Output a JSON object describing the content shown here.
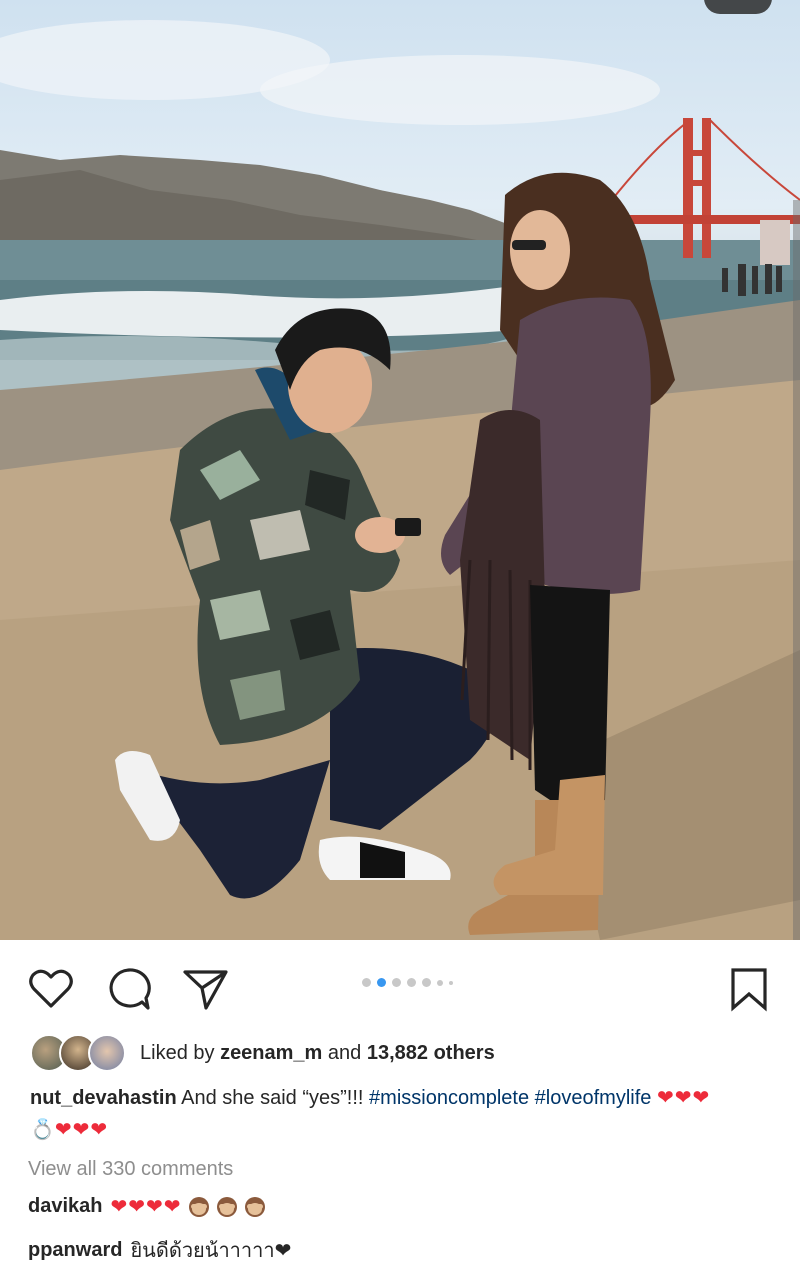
{
  "post": {
    "image_alt_icon": "photo",
    "carousel": {
      "total_dots": 7,
      "active_index": 1
    }
  },
  "actions": {
    "like_icon": "heart-outline-icon",
    "comment_icon": "speech-bubble-icon",
    "share_icon": "paper-plane-icon",
    "save_icon": "bookmark-icon"
  },
  "likes": {
    "prefix": "Liked by",
    "user": "zeenam_m",
    "joiner": "and",
    "count_text": "13,882 others"
  },
  "caption": {
    "username": "nut_devahastin",
    "text": "And she said “yes”!!!",
    "hashtags": [
      "#missioncomplete",
      "#loveofmylife"
    ],
    "trailing_emojis_1": "❤❤❤",
    "ring_emoji": "💍",
    "trailing_emojis_2": "❤❤❤"
  },
  "comments": {
    "view_all": "View all 330 comments",
    "items": [
      {
        "username": "davikah",
        "text": "❤❤❤❤",
        "extra_icon": "see-no-evil-monkey-icon"
      },
      {
        "username": "ppanward",
        "text": "ยินดีด้วยน้าาาาา❤"
      }
    ]
  },
  "colors": {
    "link_hashtag": "#003569",
    "muted": "#8e8e8e",
    "heart_red": "#ed2b3a",
    "carousel_active": "#3897f0"
  }
}
